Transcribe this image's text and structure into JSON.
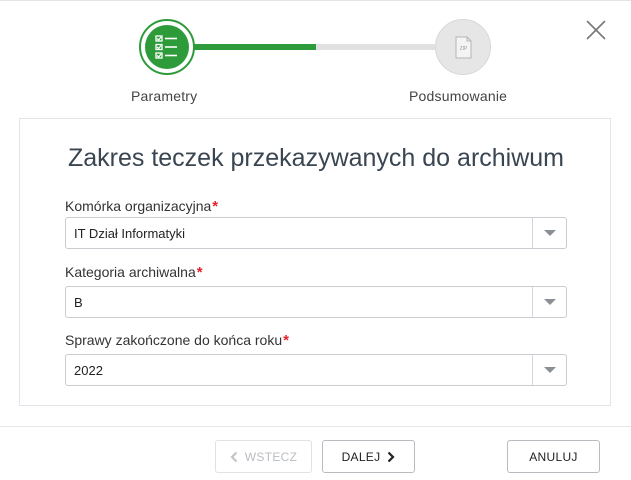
{
  "stepper": {
    "steps": [
      {
        "label": "Parametry",
        "icon": "checklist-icon",
        "state": "active"
      },
      {
        "label": "Podsumowanie",
        "icon": "zip-file-icon",
        "state": "inactive"
      }
    ],
    "progress_fraction": 0.5,
    "zip_text": "ZIP"
  },
  "panel": {
    "title": "Zakres teczek przekazywanych do archiwum",
    "required_mark": "*",
    "fields": [
      {
        "label": "Komórka organizacyjna",
        "value": "IT Dział Informatyki"
      },
      {
        "label": "Kategoria archiwalna",
        "value": "B"
      },
      {
        "label": "Sprawy zakończone do końca roku",
        "value": "2022"
      }
    ]
  },
  "footer": {
    "back_label": "WSTECZ",
    "next_label": "DALEJ",
    "cancel_label": "ANULUJ"
  },
  "colors": {
    "accent": "#2e9b3a",
    "required": "#e5202a",
    "track": "#e1e1e1"
  }
}
